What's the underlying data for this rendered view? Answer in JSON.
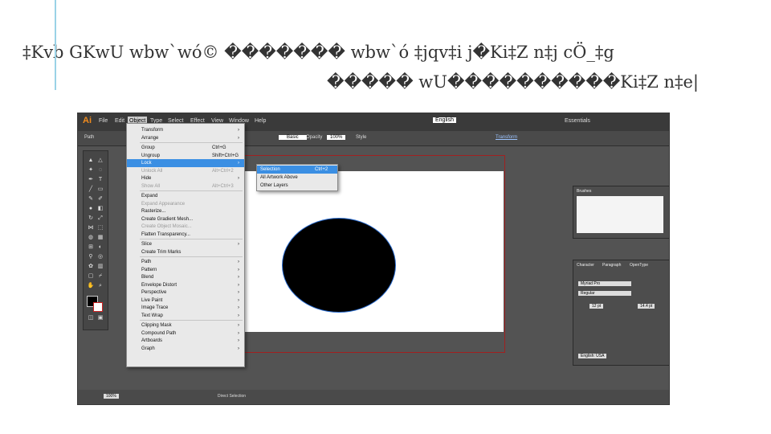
{
  "slide": {
    "title_line1": "‡Kvb GKwU wbw`wó© ������� wbw`ó ‡jqv‡i j�Ki‡Z n‡j cÖ_‡g",
    "title_line2": "����� wU����������Ki‡Z n‡e|"
  },
  "app": {
    "logo": "Ai",
    "menus": [
      "File",
      "Edit",
      "Object",
      "Type",
      "Select",
      "Effect",
      "View",
      "Window",
      "Help"
    ],
    "active_menu": "Object",
    "language": "English",
    "workspace": "Essentials",
    "control": {
      "path_label": "Path",
      "opacity_label": "Opacity",
      "opacity_value": "100%",
      "style_label": "Style",
      "basic_label": "Basic",
      "transform_label": "Transform"
    }
  },
  "object_menu": [
    {
      "label": "Transform",
      "arrow": true
    },
    {
      "label": "Arrange",
      "arrow": true
    },
    {
      "sep": true
    },
    {
      "label": "Group",
      "shortcut": "Ctrl+G"
    },
    {
      "label": "Ungroup",
      "shortcut": "Shift+Ctrl+G"
    },
    {
      "label": "Lock",
      "arrow": true,
      "highlight": true
    },
    {
      "label": "Unlock All",
      "shortcut": "Alt+Ctrl+2",
      "disabled": true
    },
    {
      "label": "Hide",
      "arrow": true
    },
    {
      "label": "Show All",
      "shortcut": "Alt+Ctrl+3",
      "disabled": true
    },
    {
      "sep": true
    },
    {
      "label": "Expand"
    },
    {
      "label": "Expand Appearance",
      "disabled": true
    },
    {
      "label": "Rasterize..."
    },
    {
      "label": "Create Gradient Mesh..."
    },
    {
      "label": "Create Object Mosaic...",
      "disabled": true
    },
    {
      "label": "Flatten Transparency..."
    },
    {
      "sep": true
    },
    {
      "label": "Slice",
      "arrow": true
    },
    {
      "label": "Create Trim Marks"
    },
    {
      "sep": true
    },
    {
      "label": "Path",
      "arrow": true
    },
    {
      "label": "Pattern",
      "arrow": true
    },
    {
      "label": "Blend",
      "arrow": true
    },
    {
      "label": "Envelope Distort",
      "arrow": true
    },
    {
      "label": "Perspective",
      "arrow": true
    },
    {
      "label": "Live Paint",
      "arrow": true
    },
    {
      "label": "Image Trace",
      "arrow": true
    },
    {
      "label": "Text Wrap",
      "arrow": true
    },
    {
      "sep": true
    },
    {
      "label": "Clipping Mask",
      "arrow": true
    },
    {
      "label": "Compound Path",
      "arrow": true
    },
    {
      "label": "Artboards",
      "arrow": true
    },
    {
      "label": "Graph",
      "arrow": true
    }
  ],
  "lock_submenu": [
    {
      "label": "Selection",
      "shortcut": "Ctrl+2",
      "highlight": true
    },
    {
      "label": "All Artwork Above"
    },
    {
      "label": "Other Layers"
    }
  ],
  "panels": {
    "brushes_title": "Brushes",
    "char_tabs": [
      "Character",
      "Paragraph",
      "OpenType"
    ],
    "font_name": "Myriad Pro",
    "font_style": "Regular",
    "font_size": "12 pt",
    "leading": "14.4 pt",
    "language": "English: USA"
  },
  "status": {
    "zoom": "100%",
    "tool": "Direct Selection"
  },
  "colors": {
    "accent": "#3b8fe3",
    "artboard_border": "#a12020",
    "app_bg": "#535353"
  }
}
